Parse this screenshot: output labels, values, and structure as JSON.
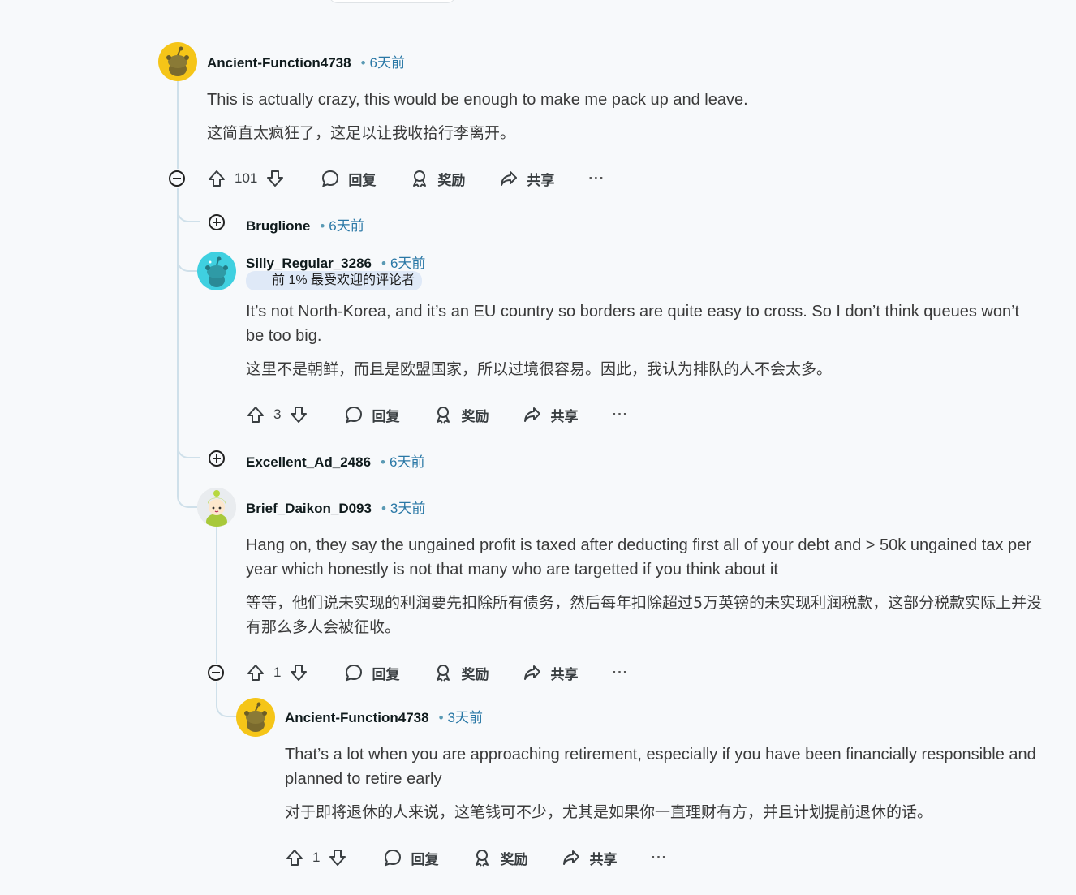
{
  "comments": [
    {
      "username": "Ancient-Function4738",
      "time": "6天前",
      "text_en": "This is actually crazy, this would be enough to make me pack up and leave.",
      "text_zh": "这简直太疯狂了，这足以让我收拾行李离开。",
      "score": "101"
    },
    {
      "username": "Bruglione",
      "time": "6天前"
    },
    {
      "username": "Silly_Regular_3286",
      "time": "6天前",
      "flair": "前 1% 最受欢迎的评论者",
      "text_en": "It’s not North-Korea, and it’s an EU country so borders are quite easy to cross. So I don’t think queues won’t be too big.",
      "text_zh": "这里不是朝鲜，而且是欧盟国家，所以过境很容易。因此，我认为排队的人不会太多。",
      "score": "3"
    },
    {
      "username": "Excellent_Ad_2486",
      "time": "6天前"
    },
    {
      "username": "Brief_Daikon_D093",
      "time": "3天前",
      "text_en": "Hang on, they say the ungained profit is taxed after deducting first all of your debt and > 50k ungained tax per year which honestly is not that many who are targetted if you think about it",
      "text_zh": "等等，他们说未实现的利润要先扣除所有债务，然后每年扣除超过5万英镑的未实现利润税款，这部分税款实际上并没有那么多人会被征收。",
      "score": "1"
    },
    {
      "username": "Ancient-Function4738",
      "time": "3天前",
      "text_en": "That’s a lot when you are approaching retirement, especially if you have been financially responsible and planned to retire early",
      "text_zh": "对于即将退休的人来说，这笔钱可不少，尤其是如果你一直理财有方，并且计划提前退休的话。",
      "score": "1"
    }
  ],
  "labels": {
    "reply": "回复",
    "award": "奖励",
    "share": "共享",
    "more": "···",
    "separator": "•"
  },
  "colors": {
    "background": "#f7f9fb",
    "thread_line": "#cfe0ea",
    "timestamp": "#2a78a6",
    "flair_bg": "#dfe9f7",
    "avatar_yellow": "#f5c518",
    "avatar_cyan": "#3fd0e0"
  }
}
